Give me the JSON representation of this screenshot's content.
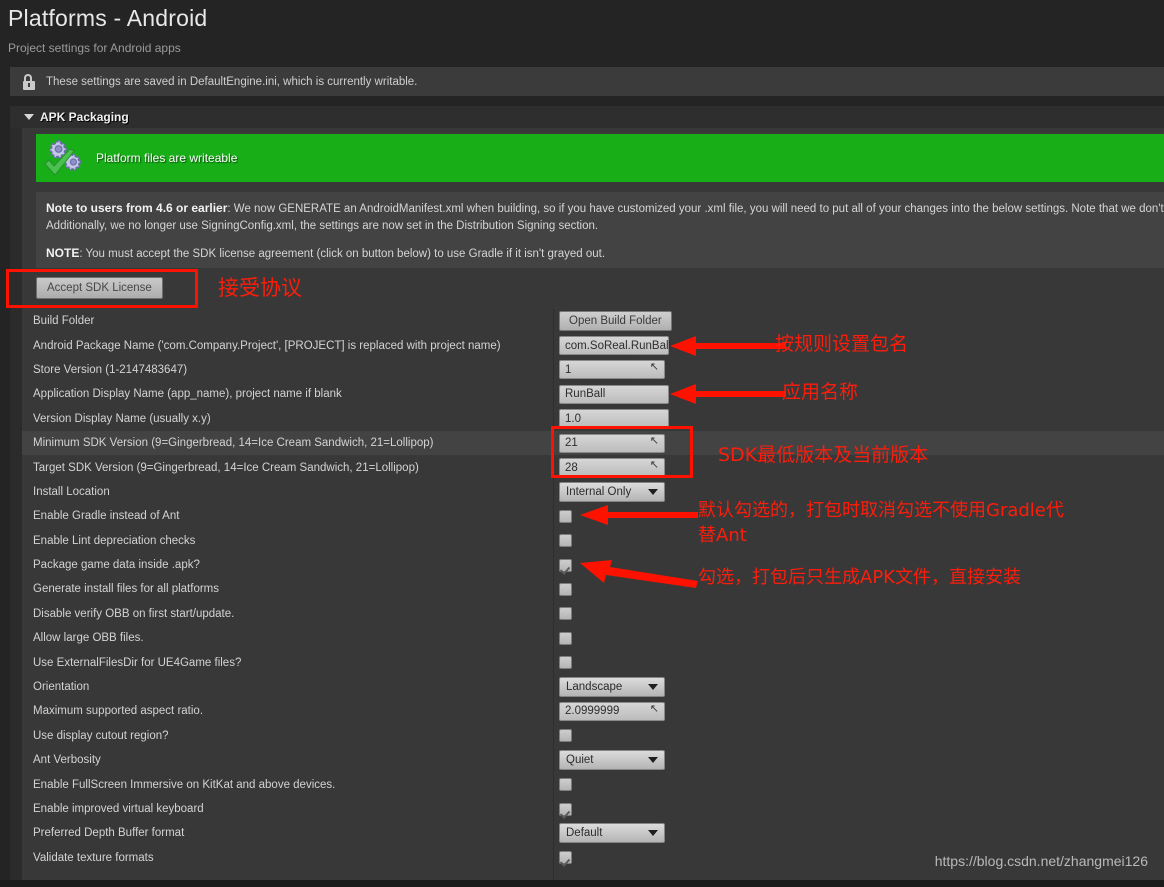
{
  "header": {
    "title": "Platforms - Android",
    "subtitle": "Project settings for Android apps"
  },
  "saved_notice": {
    "icon": "unlocked-lock-icon",
    "text": "These settings are saved in DefaultEngine.ini, which is currently writable."
  },
  "category": {
    "title": "APK Packaging",
    "expanded": true
  },
  "writeable_banner": {
    "icon": "gears-check-icon",
    "text": "Platform files are writeable",
    "color": "#17ae17"
  },
  "note_block": {
    "line1_strong": "Note to users from 4.6 or earlier",
    "line1_rest": ": We now GENERATE an AndroidManifest.xml when building, so if you have customized your .xml file, you will need to put all of your changes into the below settings. Note that we don't touch",
    "line2": "Additionally, we no longer use SigningConfig.xml, the settings are now set in the Distribution Signing section.",
    "line3_strong": "NOTE",
    "line3_rest": ": You must accept the SDK license agreement (click on button below) to use Gradle if it isn't grayed out."
  },
  "license": {
    "button_label": "Accept SDK License"
  },
  "rows": [
    {
      "label": "Build Folder",
      "control": "button",
      "value": "Open Build Folder",
      "highlight": false
    },
    {
      "label": "Android Package Name ('com.Company.Project', [PROJECT] is replaced with project name)",
      "control": "text",
      "value": "com.SoReal.RunBall",
      "highlight": false
    },
    {
      "label": "Store Version (1-2147483647)",
      "control": "number",
      "value": "1",
      "highlight": false
    },
    {
      "label": "Application Display Name (app_name), project name if blank",
      "control": "text",
      "value": "RunBall",
      "highlight": false
    },
    {
      "label": "Version Display Name (usually x.y)",
      "control": "text",
      "value": "1.0",
      "highlight": false
    },
    {
      "label": "Minimum SDK Version (9=Gingerbread, 14=Ice Cream Sandwich, 21=Lollipop)",
      "control": "number",
      "value": "21",
      "highlight": true
    },
    {
      "label": "Target SDK Version (9=Gingerbread, 14=Ice Cream Sandwich, 21=Lollipop)",
      "control": "number",
      "value": "28",
      "highlight": false
    },
    {
      "label": "Install Location",
      "control": "combo",
      "value": "Internal Only",
      "highlight": false
    },
    {
      "label": "Enable Gradle instead of Ant",
      "control": "checkbox",
      "value": "",
      "checked": false,
      "highlight": false
    },
    {
      "label": "Enable Lint depreciation checks",
      "control": "checkbox",
      "value": "",
      "checked": false,
      "highlight": false
    },
    {
      "label": "Package game data inside .apk?",
      "control": "checkbox",
      "value": "",
      "checked": true,
      "highlight": false
    },
    {
      "label": "Generate install files for all platforms",
      "control": "checkbox",
      "value": "",
      "checked": false,
      "highlight": false
    },
    {
      "label": "Disable verify OBB on first start/update.",
      "control": "checkbox",
      "value": "",
      "checked": false,
      "highlight": false
    },
    {
      "label": "Allow large OBB files.",
      "control": "checkbox",
      "value": "",
      "checked": false,
      "highlight": false
    },
    {
      "label": "Use ExternalFilesDir for UE4Game files?",
      "control": "checkbox",
      "value": "",
      "checked": false,
      "highlight": false
    },
    {
      "label": "Orientation",
      "control": "combo",
      "value": "Landscape",
      "highlight": false
    },
    {
      "label": "Maximum supported aspect ratio.",
      "control": "number",
      "value": "2.0999999",
      "highlight": false
    },
    {
      "label": "Use display cutout region?",
      "control": "checkbox",
      "value": "",
      "checked": false,
      "highlight": false
    },
    {
      "label": "Ant Verbosity",
      "control": "combo",
      "value": "Quiet",
      "highlight": false
    },
    {
      "label": "Enable FullScreen Immersive on KitKat and above devices.",
      "control": "checkbox",
      "value": "",
      "checked": false,
      "highlight": false
    },
    {
      "label": "Enable improved virtual keyboard",
      "control": "checkbox",
      "value": "",
      "checked": true,
      "highlight": false
    },
    {
      "label": "Preferred Depth Buffer format",
      "control": "combo",
      "value": "Default",
      "highlight": false
    },
    {
      "label": "Validate texture formats",
      "control": "checkbox",
      "value": "",
      "checked": true,
      "highlight": false
    }
  ],
  "annotations": {
    "color": "#fc1d0b",
    "accept_license": "接受协议",
    "package_name": "按规则设置包名",
    "app_name": "应用名称",
    "sdk_versions": "SDK最低版本及当前版本",
    "gradle_line1": "默认勾选的，打包时取消勾选不使用Gradle代",
    "gradle_line2": "替Ant",
    "apk_only": "勾选，打包后只生成APK文件，直接安装"
  },
  "watermark": "https://blog.csdn.net/zhangmei126"
}
